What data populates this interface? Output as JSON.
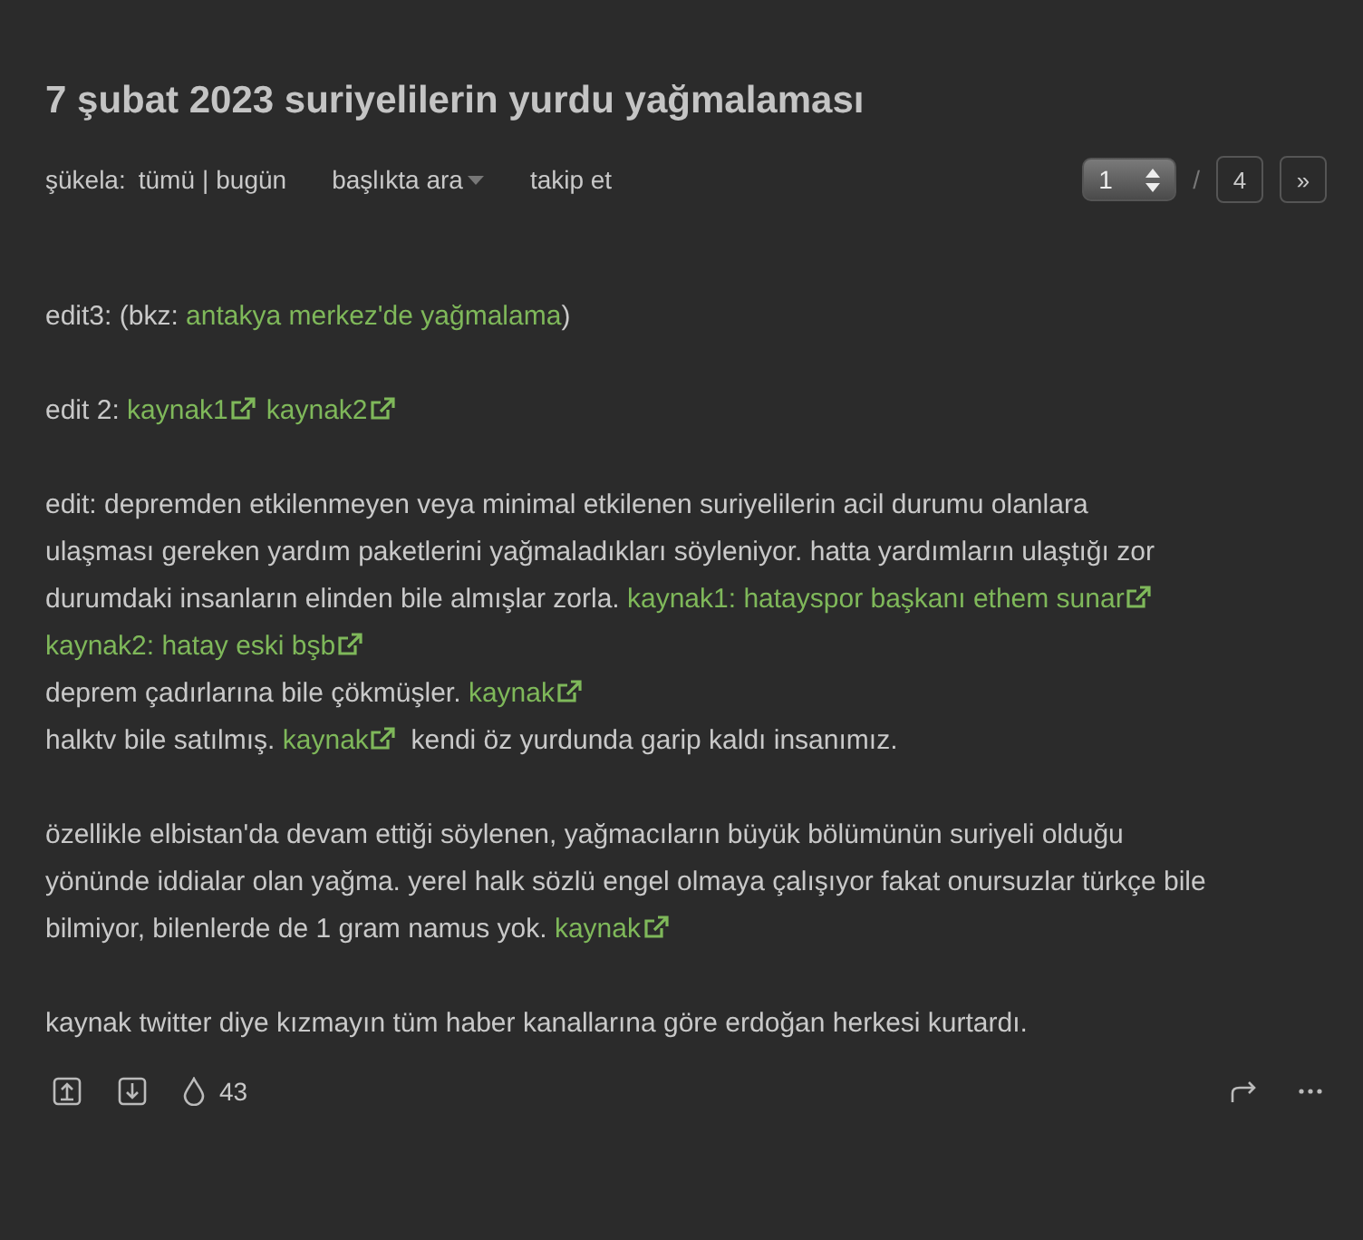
{
  "title": "7 şubat 2023 suriyelilerin yurdu yağmalaması",
  "meta": {
    "sort_label": "şükela:",
    "sort_options": [
      "tümü",
      "bugün"
    ],
    "separator": "|",
    "search": "başlıkta ara",
    "follow": "takip et"
  },
  "pager": {
    "current": "1",
    "separator": "/",
    "total": "4",
    "next": "»"
  },
  "paragraphs": [
    {
      "lines": [
        [
          {
            "kind": "text",
            "text": "edit3: (bkz: "
          },
          {
            "kind": "link",
            "text": "antakya merkez'de yağmalama"
          },
          {
            "kind": "text",
            "text": ")"
          }
        ]
      ]
    },
    {
      "lines": [
        [
          {
            "kind": "text",
            "text": "edit 2: "
          },
          {
            "kind": "extlink",
            "text": "kaynak1"
          },
          {
            "kind": "extlink",
            "text": "kaynak2"
          }
        ]
      ]
    },
    {
      "lines": [
        [
          {
            "kind": "text",
            "text": "edit: depremden etkilenmeyen veya minimal etkilenen suriyelilerin acil durumu olanlara"
          }
        ],
        [
          {
            "kind": "text",
            "text": "ulaşması gereken yardım paketlerini yağmaladıkları söyleniyor. hatta yardımların ulaştığı zor"
          }
        ],
        [
          {
            "kind": "text",
            "text": "durumdaki insanların elinden bile almışlar zorla. "
          },
          {
            "kind": "extlink",
            "text": "kaynak1: hatayspor başkanı ethem sunar"
          }
        ],
        [
          {
            "kind": "extlink",
            "text": "kaynak2: hatay eski bşb"
          }
        ],
        [
          {
            "kind": "text",
            "text": "deprem çadırlarına bile çökmüşler. "
          },
          {
            "kind": "extlink",
            "text": "kaynak"
          }
        ],
        [
          {
            "kind": "text",
            "text": "halktv bile satılmış. "
          },
          {
            "kind": "extlink",
            "text": "kaynak"
          },
          {
            "kind": "text",
            "text": "  kendi öz yurdunda garip kaldı insanımız."
          }
        ]
      ]
    },
    {
      "lines": [
        [
          {
            "kind": "text",
            "text": "özellikle elbistan'da devam ettiği söylenen, yağmacıların büyük bölümünün suriyeli olduğu"
          }
        ],
        [
          {
            "kind": "text",
            "text": "yönünde iddialar olan yağma. yerel halk sözlü engel olmaya çalışıyor fakat onursuzlar türkçe bile"
          }
        ],
        [
          {
            "kind": "text",
            "text": "bilmiyor, bilenlerde de 1 gram namus yok. "
          },
          {
            "kind": "extlink",
            "text": "kaynak"
          }
        ]
      ]
    },
    {
      "lines": [
        [
          {
            "kind": "text",
            "text": "kaynak twitter diye kızmayın tüm haber kanallarına göre erdoğan herkesi kurtardı."
          }
        ]
      ]
    }
  ],
  "footer": {
    "favorites": "43"
  }
}
